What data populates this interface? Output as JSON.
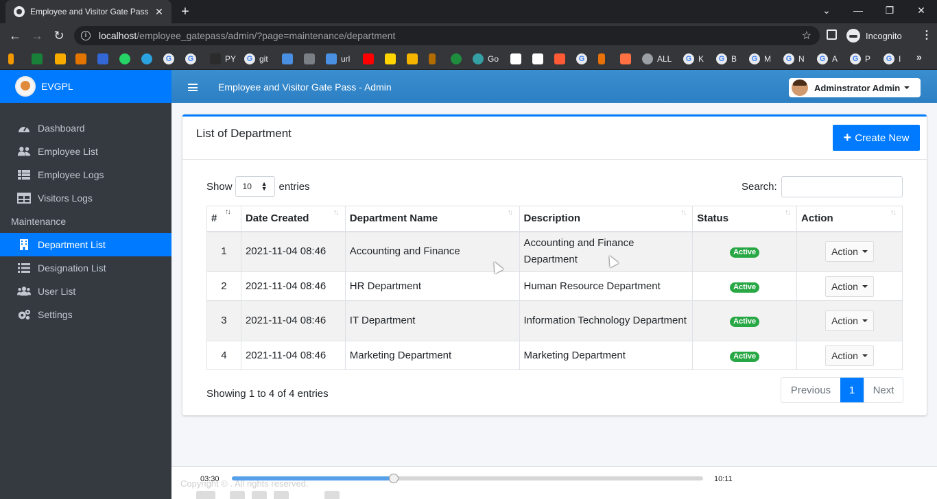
{
  "browser": {
    "tab_title": "Employee and Visitor Gate Pass",
    "url_host": "localhost",
    "url_path": "/employee_gatepass/admin/?page=maintenance/department",
    "profile": "Incognito",
    "bookmarks": [
      "PY",
      "git",
      "url",
      "Go",
      "ALL",
      "K",
      "B",
      "M",
      "N",
      "A",
      "P",
      "I"
    ]
  },
  "sidebar": {
    "brand": "EVGPL",
    "items": [
      {
        "label": "Dashboard",
        "icon": "tachometer-icon"
      },
      {
        "label": "Employee List",
        "icon": "users-icon"
      },
      {
        "label": "Employee Logs",
        "icon": "list-table-icon"
      },
      {
        "label": "Visitors Logs",
        "icon": "table-icon"
      }
    ],
    "section": "Maintenance",
    "maintenance_items": [
      {
        "label": "Department List",
        "icon": "building-icon",
        "active": true
      },
      {
        "label": "Designation List",
        "icon": "list-icon"
      },
      {
        "label": "User List",
        "icon": "users-icon"
      },
      {
        "label": "Settings",
        "icon": "gears-icon"
      }
    ]
  },
  "header": {
    "title": "Employee and Visitor Gate Pass - Admin",
    "user": "Adminstrator Admin"
  },
  "card": {
    "title": "List of Department",
    "create_label": "Create New",
    "show_label": "Show",
    "entries_value": "10",
    "entries_label": "entries",
    "search_label": "Search:",
    "columns": [
      "#",
      "Date Created",
      "Department Name",
      "Description",
      "Status",
      "Action"
    ],
    "rows": [
      {
        "num": "1",
        "date": "2021-11-04 08:46",
        "name": "Accounting and Finance",
        "desc": "Accounting and Finance Department",
        "status": "Active",
        "action": "Action"
      },
      {
        "num": "2",
        "date": "2021-11-04 08:46",
        "name": "HR Department",
        "desc": "Human Resource Department",
        "status": "Active",
        "action": "Action"
      },
      {
        "num": "3",
        "date": "2021-11-04 08:46",
        "name": "IT Department",
        "desc": "Information Technology Department",
        "status": "Active",
        "action": "Action"
      },
      {
        "num": "4",
        "date": "2021-11-04 08:46",
        "name": "Marketing Department",
        "desc": "Marketing Department",
        "status": "Active",
        "action": "Action"
      }
    ],
    "info": "Showing 1 to 4 of 4 entries",
    "pager": {
      "prev": "Previous",
      "current": "1",
      "next": "Next"
    }
  },
  "footer": {
    "copyright": "Copyright © . All rights reserved."
  },
  "player": {
    "elapsed": "03:30",
    "total": "10:11",
    "progress": 0.344
  },
  "colors": {
    "primary": "#007bff",
    "sidebar": "#343a40",
    "success": "#28a745"
  }
}
